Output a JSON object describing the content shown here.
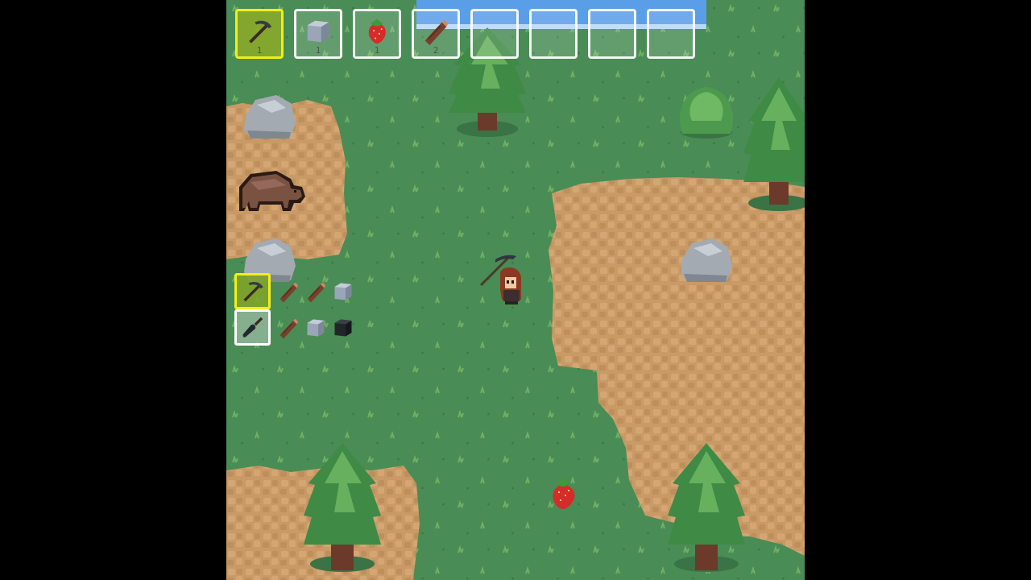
{
  "hotbar": {
    "selected_index": 0,
    "slots": [
      {
        "item": "pickaxe",
        "icon": "pickaxe-icon",
        "count": "1"
      },
      {
        "item": "stone",
        "icon": "stone-icon",
        "count": "1"
      },
      {
        "item": "strawberry",
        "icon": "strawberry-icon",
        "count": "1"
      },
      {
        "item": "wood",
        "icon": "log-icon",
        "count": "2"
      },
      {
        "item": "",
        "icon": "",
        "count": ""
      },
      {
        "item": "",
        "icon": "",
        "count": ""
      },
      {
        "item": "",
        "icon": "",
        "count": ""
      },
      {
        "item": "",
        "icon": "",
        "count": ""
      }
    ]
  },
  "crafting": {
    "recipes": [
      {
        "result": "pickaxe",
        "icon": "pickaxe-icon",
        "selected": true,
        "ingredients": [
          "log-icon",
          "log-icon",
          "stone-icon"
        ]
      },
      {
        "result": "shovel",
        "icon": "shovel-icon",
        "selected": false,
        "ingredients": [
          "log-icon",
          "stone-icon",
          "coal-icon"
        ]
      }
    ]
  },
  "world": {
    "player": {
      "name": "player",
      "held_item": "pickaxe"
    },
    "entities": [
      "bear",
      "strawberry-pickup"
    ],
    "terrain": [
      "grass",
      "dirt",
      "water"
    ]
  },
  "colors": {
    "grass": "#4a8c55",
    "dirt": "#c99a66",
    "water": "#5a9ee8",
    "tree_dark": "#2e6b3a",
    "tree_light": "#5aa05a",
    "rock": "#a3aab2",
    "hotbar_border": "#ffffff",
    "selected_border": "#f2ee1a",
    "frame": "#000000"
  }
}
